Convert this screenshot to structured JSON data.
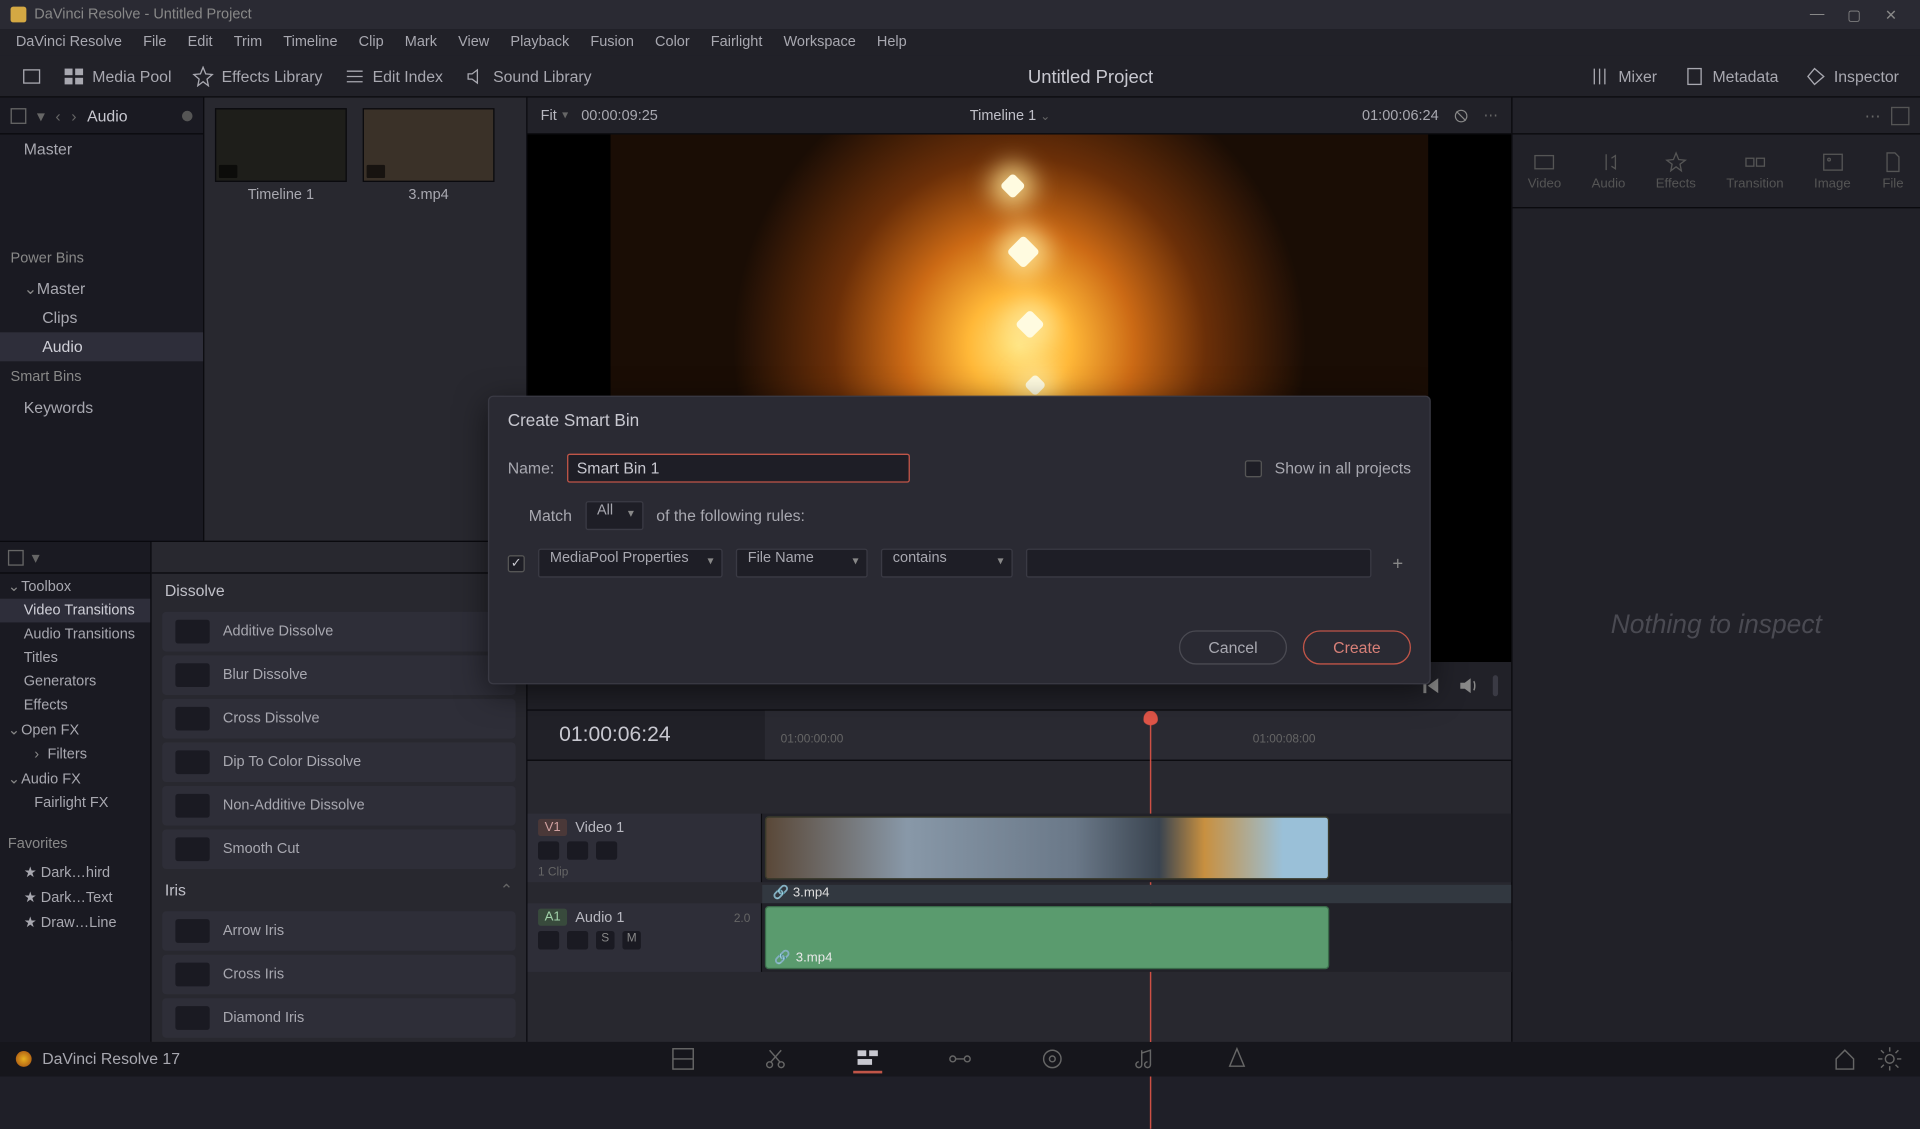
{
  "titlebar": {
    "text": "DaVinci Resolve - Untitled Project"
  },
  "menubar": [
    "DaVinci Resolve",
    "File",
    "Edit",
    "Trim",
    "Timeline",
    "Clip",
    "Mark",
    "View",
    "Playback",
    "Fusion",
    "Color",
    "Fairlight",
    "Workspace",
    "Help"
  ],
  "toolbar": {
    "media_pool": "Media Pool",
    "effects_library": "Effects Library",
    "edit_index": "Edit Index",
    "sound_library": "Sound Library",
    "project_title": "Untitled Project",
    "mixer": "Mixer",
    "metadata": "Metadata",
    "inspector": "Inspector"
  },
  "bins_panel": {
    "title": "Audio",
    "master": "Master",
    "power_bins": "Power Bins",
    "pb_master": "Master",
    "pb_clips": "Clips",
    "pb_audio": "Audio",
    "smart_bins": "Smart Bins",
    "sb_keywords": "Keywords"
  },
  "media_items": [
    {
      "name": "Timeline 1"
    },
    {
      "name": "3.mp4"
    }
  ],
  "fx_tree": {
    "toolbox": "Toolbox",
    "video_trans": "Video Transitions",
    "audio_trans": "Audio Transitions",
    "titles": "Titles",
    "generators": "Generators",
    "effects": "Effects",
    "openfx": "Open FX",
    "filters": "Filters",
    "audiofx": "Audio FX",
    "fairlightfx": "Fairlight FX",
    "favorites": "Favorites",
    "fav1": "Dark…hird",
    "fav2": "Dark…Text",
    "fav3": "Draw…Line"
  },
  "fx_list": {
    "cat_dissolve": "Dissolve",
    "items_dissolve": [
      "Additive Dissolve",
      "Blur Dissolve",
      "Cross Dissolve",
      "Dip To Color Dissolve",
      "Non-Additive Dissolve",
      "Smooth Cut"
    ],
    "cat_iris": "Iris",
    "items_iris": [
      "Arrow Iris",
      "Cross Iris",
      "Diamond Iris"
    ]
  },
  "viewer": {
    "fit": "Fit",
    "tc_in": "00:00:09:25",
    "timeline_name": "Timeline 1",
    "tc_out": "01:00:06:24"
  },
  "timeline": {
    "tc": "01:00:06:24",
    "tick1": "01:00:00:00",
    "tick2": "01:00:08:00",
    "v1_badge": "V1",
    "v1_name": "Video 1",
    "v1_sub": "1 Clip",
    "a1_badge": "A1",
    "a1_name": "Audio 1",
    "a1_meter": "2.0",
    "clip_name": "3.mp4"
  },
  "inspector": {
    "tabs": [
      "Video",
      "Audio",
      "Effects",
      "Transition",
      "Image",
      "File"
    ],
    "empty": "Nothing to inspect"
  },
  "modal": {
    "title": "Create Smart Bin",
    "name_label": "Name:",
    "name_value": "Smart Bin 1",
    "show_all": "Show in all projects",
    "match": "Match",
    "match_mode": "All",
    "match_suffix": "of the following rules:",
    "rule_prop": "MediaPool Properties",
    "rule_field": "File Name",
    "rule_op": "contains",
    "cancel": "Cancel",
    "create": "Create"
  },
  "bottombar": {
    "version": "DaVinci Resolve 17"
  }
}
